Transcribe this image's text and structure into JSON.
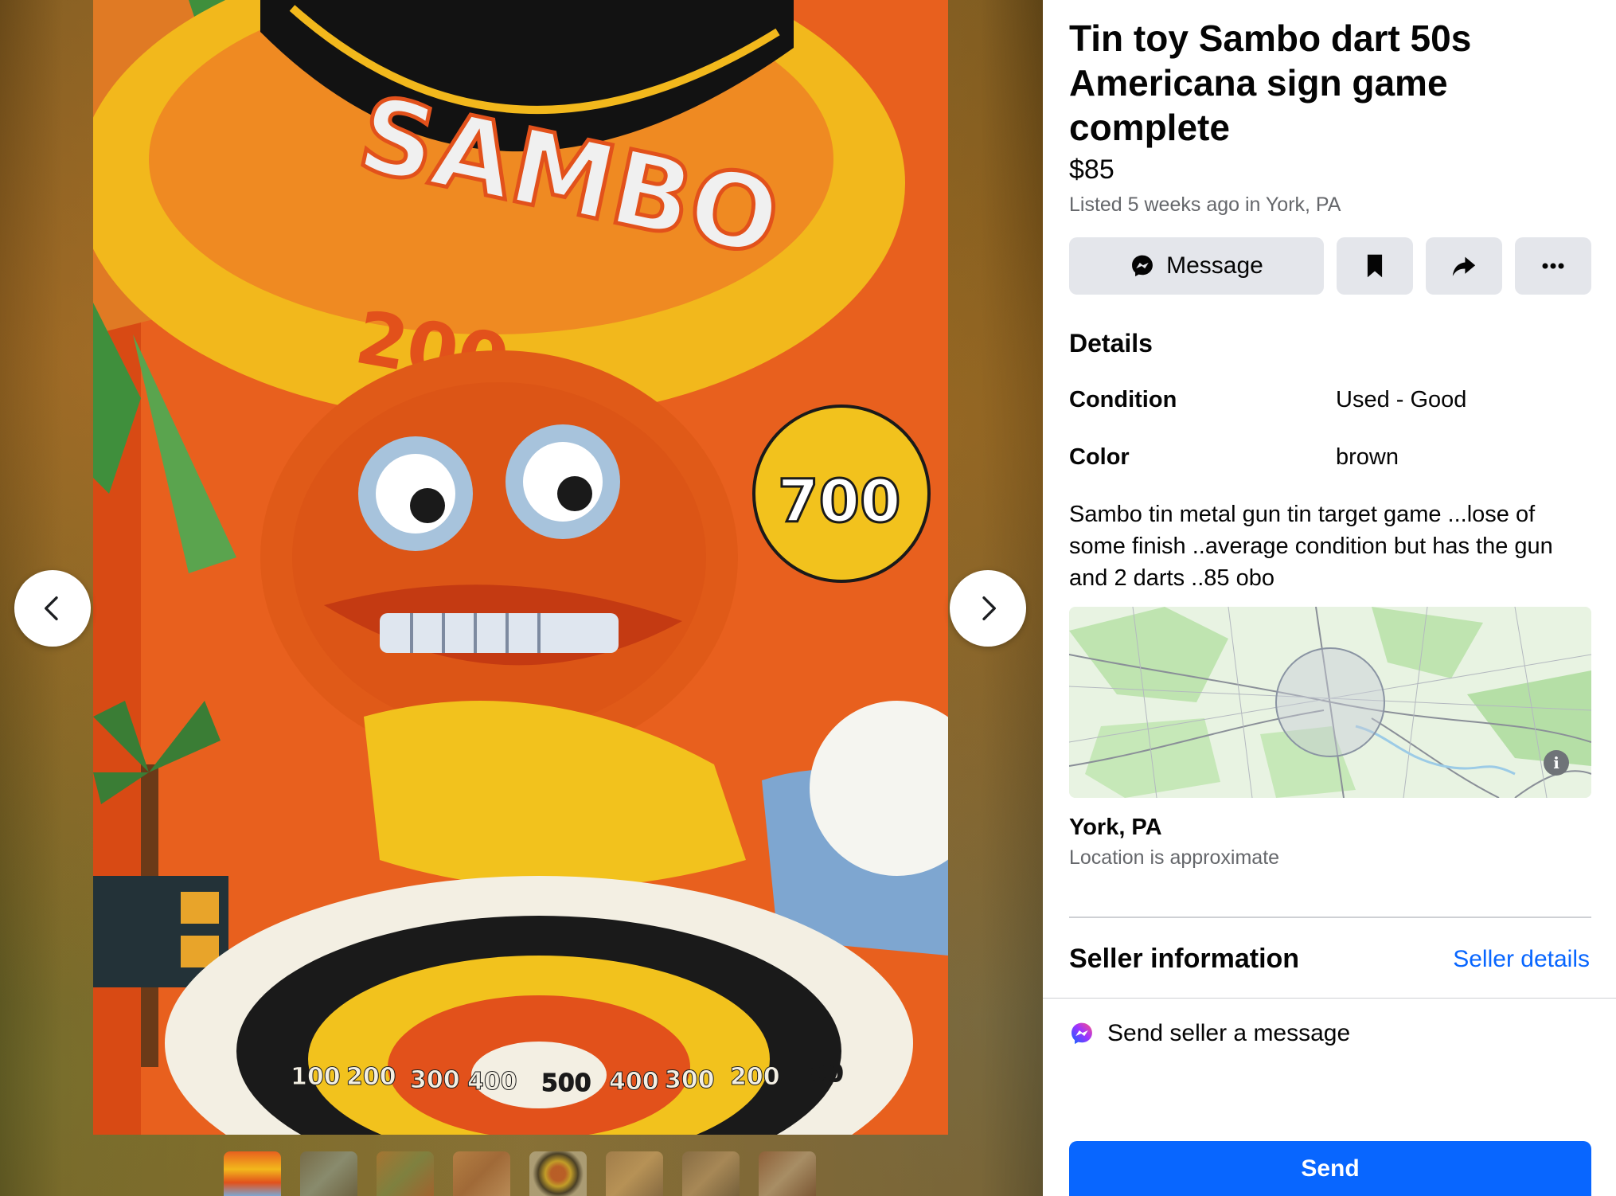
{
  "listing": {
    "title": "Tin toy Sambo dart 50s Americana sign game complete",
    "price": "$85",
    "listed": "Listed 5 weeks ago in York, PA"
  },
  "actions": {
    "message_label": "Message",
    "save_icon": "bookmark-icon",
    "share_icon": "share-icon",
    "more_icon": "more-icon"
  },
  "details": {
    "heading": "Details",
    "rows": [
      {
        "label": "Condition",
        "value": "Used - Good"
      },
      {
        "label": "Color",
        "value": "brown"
      }
    ],
    "description": "Sambo tin metal gun tin target game ...lose of some finish ..average condition but has the gun and 2 darts ..85 obo"
  },
  "location": {
    "city": "York, PA",
    "note": "Location is approximate"
  },
  "seller": {
    "heading": "Seller information",
    "details_link": "Seller details",
    "send_prompt": "Send seller a message",
    "send_button": "Send"
  },
  "photo": {
    "hat_text": "SAMBO",
    "hat_score": "200",
    "badge_700": "700",
    "target_scores": [
      "100",
      "200",
      "300",
      "400",
      "500",
      "400",
      "300",
      "200",
      "100"
    ],
    "thumbnail_count": 8
  },
  "colors": {
    "accent": "#0866ff",
    "button_gray": "#e4e6eb",
    "secondary_text": "#65676b"
  }
}
